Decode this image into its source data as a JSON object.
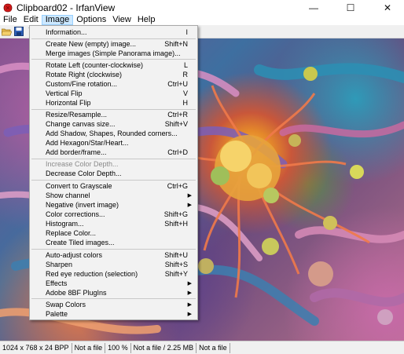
{
  "window": {
    "title": "Clipboard02 - IrfanView",
    "minimize": "—",
    "maximize": "☐",
    "close": "✕"
  },
  "menubar": [
    "File",
    "Edit",
    "Image",
    "Options",
    "View",
    "Help"
  ],
  "image_menu": {
    "items": [
      {
        "label": "Information...",
        "shortcut": "I"
      },
      {
        "label": "Create New (empty) image...",
        "shortcut": "Shift+N"
      },
      {
        "label": "Merge images (Simple Panorama image)...",
        "shortcut": ""
      },
      {
        "label": "Rotate Left (counter-clockwise)",
        "shortcut": "L"
      },
      {
        "label": "Rotate Right (clockwise)",
        "shortcut": "R"
      },
      {
        "label": "Custom/Fine rotation...",
        "shortcut": "Ctrl+U"
      },
      {
        "label": "Vertical Flip",
        "shortcut": "V"
      },
      {
        "label": "Horizontal Flip",
        "shortcut": "H"
      },
      {
        "label": "Resize/Resample...",
        "shortcut": "Ctrl+R"
      },
      {
        "label": "Change canvas size...",
        "shortcut": "Shift+V"
      },
      {
        "label": "Add Shadow, Shapes, Rounded corners...",
        "shortcut": ""
      },
      {
        "label": "Add Hexagon/Star/Heart...",
        "shortcut": ""
      },
      {
        "label": "Add border/frame...",
        "shortcut": "Ctrl+D"
      },
      {
        "label": "Increase Color Depth...",
        "shortcut": ""
      },
      {
        "label": "Decrease Color Depth...",
        "shortcut": ""
      },
      {
        "label": "Convert to Grayscale",
        "shortcut": "Ctrl+G"
      },
      {
        "label": "Show channel",
        "shortcut": ""
      },
      {
        "label": "Negative (invert image)",
        "shortcut": ""
      },
      {
        "label": "Color corrections...",
        "shortcut": "Shift+G"
      },
      {
        "label": "Histogram...",
        "shortcut": "Shift+H"
      },
      {
        "label": "Replace Color...",
        "shortcut": ""
      },
      {
        "label": "Create Tiled images...",
        "shortcut": ""
      },
      {
        "label": "Auto-adjust colors",
        "shortcut": "Shift+U"
      },
      {
        "label": "Sharpen",
        "shortcut": "Shift+S"
      },
      {
        "label": "Red eye reduction (selection)",
        "shortcut": "Shift+Y"
      },
      {
        "label": "Effects",
        "shortcut": ""
      },
      {
        "label": "Adobe 8BF PlugIns",
        "shortcut": ""
      },
      {
        "label": "Swap Colors",
        "shortcut": ""
      },
      {
        "label": "Palette",
        "shortcut": ""
      }
    ]
  },
  "statusbar": {
    "dimensions": "1024 x 768 x 24 BPP",
    "file1": "Not a file",
    "zoom": "100 %",
    "file_size": "Not a file / 2.25 MB",
    "file2": "Not a file"
  },
  "colors": {
    "menu_bg": "#f2f2f2",
    "menu_active": "#cce8ff",
    "disabled_text": "#8a8a8a"
  }
}
